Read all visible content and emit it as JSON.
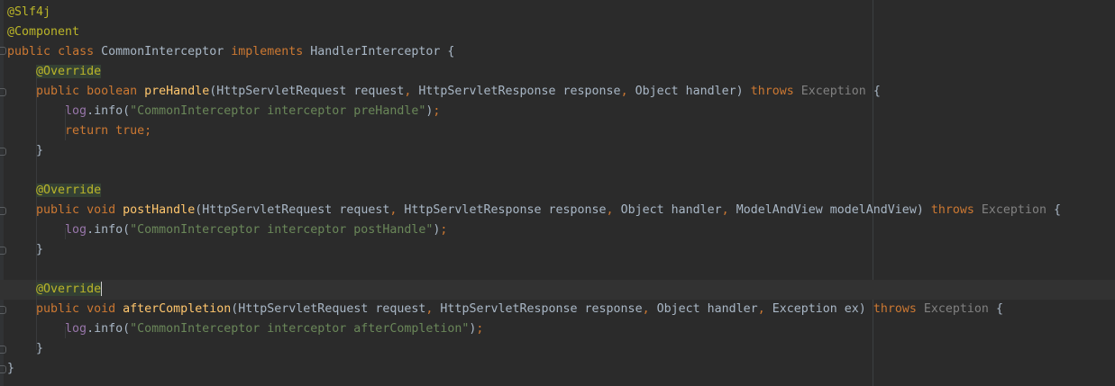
{
  "code": {
    "annotations": {
      "slf4j": "@Slf4j",
      "component": "@Component",
      "override": "@Override"
    },
    "keywords": {
      "public": "public",
      "class": "class",
      "implements": "implements",
      "boolean": "boolean",
      "void": "void",
      "throws": "throws",
      "return": "return",
      "true": "true"
    },
    "class_name": "CommonInterceptor",
    "interface_name": "HandlerInterceptor",
    "exception_type": "Exception",
    "log_field": "log",
    "info_call": ".info(",
    "params": {
      "request": "HttpServletRequest request",
      "response": "HttpServletResponse response",
      "handler": "Object handler",
      "model_and_view": "ModelAndView modelAndView",
      "ex": "Exception ex"
    },
    "methods": {
      "pre_handle": {
        "name": "preHandle",
        "message": "\"CommonInterceptor interceptor preHandle\""
      },
      "post_handle": {
        "name": "postHandle",
        "message": "\"CommonInterceptor interceptor postHandle\""
      },
      "after_completion": {
        "name": "afterCompletion",
        "message": "\"CommonInterceptor interceptor afterCompletion\""
      }
    }
  },
  "colors": {
    "background": "#2b2b2b",
    "keyword": "#cc7832",
    "annotation": "#bbb529",
    "method_name": "#ffc66d",
    "string": "#6a8759",
    "field": "#9876aa",
    "default_text": "#a9b7c6",
    "dim_exception": "#808080"
  }
}
